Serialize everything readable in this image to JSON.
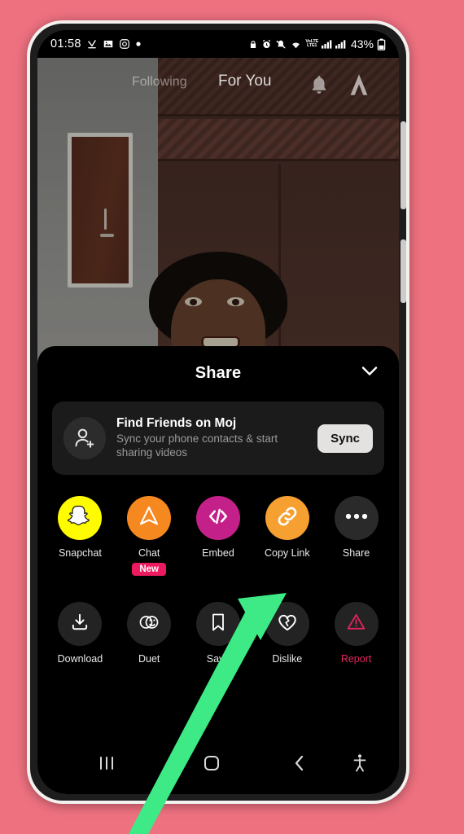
{
  "theme": {
    "page_background": "#ee7180",
    "sheet_background": "#000000",
    "accent_orange": "#f5a030",
    "accent_pink": "#ec1a5f",
    "annotation_green": "#3dea86"
  },
  "status_bar": {
    "clock": "01:58",
    "battery_percent": "43%",
    "left_icons": [
      "download-icon",
      "gallery-icon",
      "instagram-icon",
      "dot-icon"
    ],
    "right_icons": [
      "lock-icon",
      "alarm-icon",
      "mute-icon",
      "wifi-icon",
      "volte-icon",
      "signal-sim1-icon",
      "signal-sim2-icon",
      "battery-icon"
    ],
    "volte_top": "VoLTE",
    "volte_bottom": "LTE1"
  },
  "top_nav": {
    "tab_following": "Following",
    "tab_for_you": "For You",
    "bell_icon": "notification-bell-icon",
    "logo_icon": "moj-logo-icon"
  },
  "share_sheet": {
    "title": "Share",
    "collapse_icon": "chevron-down-icon",
    "find_friends": {
      "avatar_icon": "person-add-icon",
      "title": "Find Friends on Moj",
      "subtitle": "Sync your phone contacts & start sharing videos",
      "button_label": "Sync"
    },
    "row1": [
      {
        "label": "Snapchat",
        "icon": "snapchat-ghost-icon",
        "bg": "#fffc00",
        "badge": ""
      },
      {
        "label": "Chat",
        "icon": "chat-arrow-icon",
        "bg": "#f5881f",
        "badge": "New"
      },
      {
        "label": "Embed",
        "icon": "code-embed-icon",
        "bg": "#c42089",
        "badge": ""
      },
      {
        "label": "Copy Link",
        "icon": "link-chain-icon",
        "bg": "#f5a030",
        "badge": ""
      },
      {
        "label": "Share",
        "icon": "more-dots-icon",
        "bg": "#2a2a2a",
        "badge": ""
      }
    ],
    "row2": [
      {
        "label": "Download",
        "icon": "download-icon",
        "bg": "#232323",
        "danger": false
      },
      {
        "label": "Duet",
        "icon": "duet-icon",
        "bg": "#232323",
        "danger": false
      },
      {
        "label": "Save",
        "icon": "bookmark-icon",
        "bg": "#232323",
        "danger": false
      },
      {
        "label": "Dislike",
        "icon": "broken-heart-icon",
        "bg": "#232323",
        "danger": false
      },
      {
        "label": "Report",
        "icon": "warning-triangle-icon",
        "bg": "#232323",
        "danger": true
      }
    ]
  },
  "nav_bar": {
    "recents_icon": "recents-icon",
    "home_icon": "home-icon",
    "back_icon": "back-icon",
    "accessibility_icon": "accessibility-icon"
  },
  "annotation": {
    "type": "arrow",
    "points_to": "Copy Link",
    "color": "#3dea86"
  }
}
